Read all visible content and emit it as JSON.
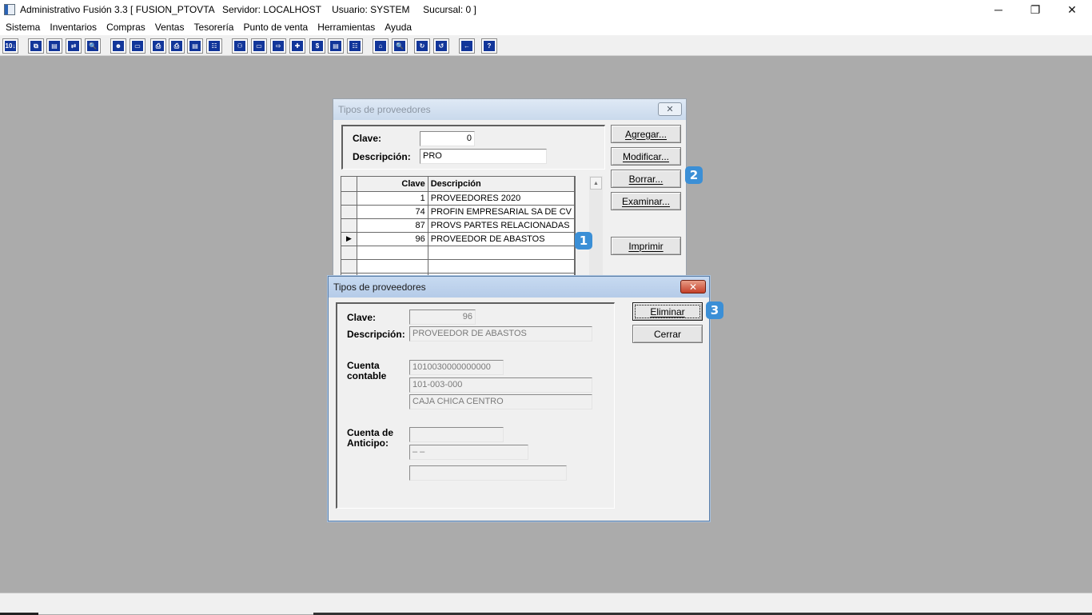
{
  "window": {
    "title": "Administrativo Fusión 3.3 [ FUSION_PTOVTA   Servidor: LOCALHOST    Usuario: SYSTEM     Sucursal: 0 ]",
    "minimize": "─",
    "restore": "❐",
    "close": "✕"
  },
  "menu": [
    "Sistema",
    "Inventarios",
    "Compras",
    "Ventas",
    "Tesorería",
    "Punto de venta",
    "Herramientas",
    "Ayuda"
  ],
  "toolbar_icons": [
    "io-icon",
    "copy-icon",
    "clipboard-icon",
    "exchange-icon",
    "zoom-icon",
    "user-icon",
    "folder-icon",
    "print-icon",
    "printer-icon",
    "document-icon",
    "list-icon",
    "binoculars-icon",
    "folder-open-icon",
    "export-icon",
    "add-icon",
    "dollar-icon",
    "report-icon",
    "tree-icon",
    "home-icon",
    "search-icon",
    "refresh-icon",
    "undo-icon",
    "back-arrow-icon",
    "help-icon"
  ],
  "toolbar_glyphs": [
    "10↓",
    "⧉",
    "▤",
    "⇄",
    "🔍",
    "☻",
    "▭",
    "⎙",
    "⎙",
    "▤",
    "☷",
    "⚇",
    "▭",
    "⇨",
    "✚",
    "$",
    "▤",
    "☷",
    "⌂",
    "🔍",
    "↻",
    "↺",
    "←",
    "?"
  ],
  "dialog_back": {
    "title": "Tipos de proveedores",
    "close": "✕",
    "clave_label": "Clave:",
    "clave_value": "0",
    "descripcion_label": "Descripción:",
    "descripcion_value": "PRO",
    "buttons": {
      "agregar": "Agregar...",
      "modificar": "Modificar...",
      "borrar": "Borrar...",
      "examinar": "Examinar...",
      "imprimir": "Imprimir"
    },
    "grid": {
      "columns": [
        "Clave",
        "Descripción"
      ],
      "rows": [
        {
          "indicator": "",
          "clave": "1",
          "descripcion": "PROVEEDORES 2020"
        },
        {
          "indicator": "",
          "clave": "74",
          "descripcion": "PROFIN EMPRESARIAL SA DE CV"
        },
        {
          "indicator": "",
          "clave": "87",
          "descripcion": "PROVS PARTES RELACIONADAS"
        },
        {
          "indicator": "▶",
          "clave": "96",
          "descripcion": "PROVEEDOR DE ABASTOS"
        },
        {
          "indicator": "",
          "clave": "",
          "descripcion": ""
        },
        {
          "indicator": "",
          "clave": "",
          "descripcion": ""
        },
        {
          "indicator": "",
          "clave": "",
          "descripcion": ""
        }
      ]
    },
    "scroll_up": "▲"
  },
  "dialog_front": {
    "title": "Tipos de proveedores",
    "close": "✕",
    "clave_label": "Clave:",
    "clave_value": "96",
    "descripcion_label": "Descripción:",
    "descripcion_value": "PROVEEDOR DE ABASTOS",
    "cuenta_contable_label_1": "Cuenta",
    "cuenta_contable_label_2": "contable",
    "cuenta_contable_value": "1010030000000000",
    "cuenta_contable_code": "101-003-000",
    "cuenta_contable_name": "CAJA CHICA CENTRO",
    "cuenta_anticipo_label_1": "Cuenta de",
    "cuenta_anticipo_label_2": "Anticipo:",
    "cuenta_anticipo_value": "",
    "cuenta_anticipo_code": "   –      –",
    "cuenta_anticipo_name": "",
    "buttons": {
      "eliminar": "Eliminar",
      "cerrar": "Cerrar"
    }
  },
  "badges": [
    "1",
    "2",
    "3"
  ]
}
